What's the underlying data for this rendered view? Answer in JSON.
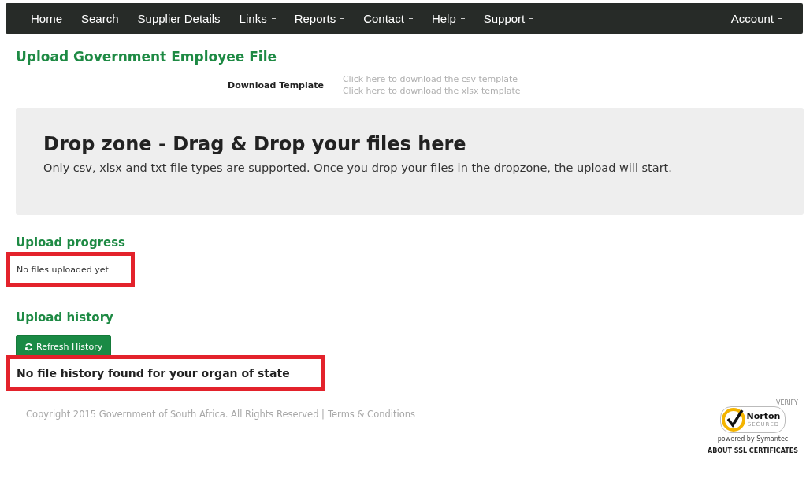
{
  "nav": {
    "items": [
      {
        "label": "Home",
        "dropdown": false
      },
      {
        "label": "Search",
        "dropdown": false
      },
      {
        "label": "Supplier Details",
        "dropdown": false
      },
      {
        "label": "Links",
        "dropdown": true
      },
      {
        "label": "Reports",
        "dropdown": true
      },
      {
        "label": "Contact",
        "dropdown": true
      },
      {
        "label": "Help",
        "dropdown": true
      },
      {
        "label": "Support",
        "dropdown": true
      }
    ],
    "account": {
      "label": "Account",
      "dropdown": true
    }
  },
  "title": "Upload Government Employee File",
  "download": {
    "label": "Download Template",
    "links": [
      "Click here to download the csv template",
      "Click here to download the xlsx template"
    ]
  },
  "dropzone": {
    "heading": "Drop zone - Drag & Drop your files here",
    "text": "Only csv, xlsx and txt file types are supported. Once you drop your files in the dropzone, the upload will start."
  },
  "progress": {
    "heading": "Upload progress",
    "message": "No files uploaded yet."
  },
  "history": {
    "heading": "Upload history",
    "button": "Refresh History",
    "message": "No file history found for your organ of state"
  },
  "footer": {
    "copyright": "Copyright 2015 Government of South Africa. All Rights Reserved |",
    "terms": "Terms & Conditions"
  },
  "badge": {
    "verify": "VERIFY",
    "name": "Norton",
    "secured": "SECURED",
    "powered": "powered by Symantec",
    "about": "ABOUT SSL CERTIFICATES"
  }
}
